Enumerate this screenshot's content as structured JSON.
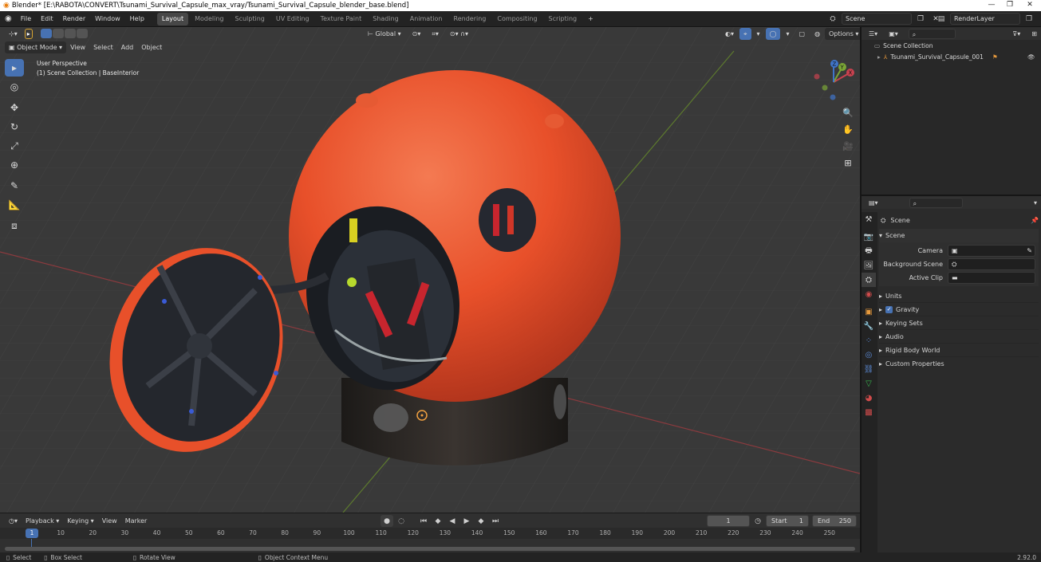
{
  "window": {
    "title": "Blender* [E:\\RABOTA\\CONVERT\\Tsunami_Survival_Capsule_max_vray/Tsunami_Survival_Capsule_blender_base.blend]",
    "minimize": "—",
    "maximize": "❐",
    "close": "✕"
  },
  "menu": [
    "File",
    "Edit",
    "Render",
    "Window",
    "Help"
  ],
  "workspaces": [
    "Layout",
    "Modeling",
    "Sculpting",
    "UV Editing",
    "Texture Paint",
    "Shading",
    "Animation",
    "Rendering",
    "Compositing",
    "Scripting"
  ],
  "workspace_add": "+",
  "scene_field": "Scene",
  "renderlayer_field": "RenderLayer",
  "viewport": {
    "mode": "Object Mode",
    "menus": [
      "View",
      "Select",
      "Add",
      "Object"
    ],
    "transform_orientation": "Global",
    "options": "Options",
    "overlay_line1": "User Perspective",
    "overlay_line2": "(1) Scene Collection | BaseInterior",
    "gizmo": {
      "x": "X",
      "y": "Y",
      "z": "Z"
    }
  },
  "timeline": {
    "menus": [
      "Playback",
      "Keying",
      "View",
      "Marker"
    ],
    "current_frame": "1",
    "start_label": "Start",
    "start_value": "1",
    "end_label": "End",
    "end_value": "250",
    "ruler": [
      "1",
      "10",
      "20",
      "30",
      "40",
      "50",
      "60",
      "70",
      "80",
      "90",
      "100",
      "110",
      "120",
      "130",
      "140",
      "150",
      "160",
      "170",
      "180",
      "190",
      "200",
      "210",
      "220",
      "230",
      "240",
      "250"
    ]
  },
  "statusbar": {
    "select": "Select",
    "box_select": "Box Select",
    "rotate_view": "Rotate View",
    "context_menu": "Object Context Menu",
    "version": "2.92.0"
  },
  "outliner": {
    "root": "Scene Collection",
    "object": "Tsunami_Survival_Capsule_001"
  },
  "properties": {
    "header": "Scene",
    "panel": "Scene",
    "camera_label": "Camera",
    "background_scene_label": "Background Scene",
    "active_clip_label": "Active Clip",
    "sections": [
      "Units",
      "Gravity",
      "Keying Sets",
      "Audio",
      "Rigid Body World",
      "Custom Properties"
    ],
    "gravity_checked": true
  },
  "colors": {
    "accent": "#4772b3",
    "capsule": "#e8502a",
    "axis_x": "#c8424f",
    "axis_y": "#7aa536",
    "axis_z": "#3f74c9"
  }
}
